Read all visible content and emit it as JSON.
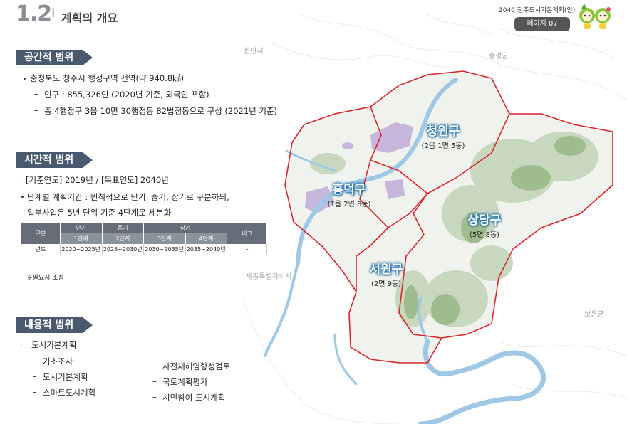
{
  "header": {
    "section_number": "1.2",
    "separator": "I",
    "title": "계획의 개요",
    "doc_title": "2040 청주도시기본계획(안)",
    "page_label": "페이지 07"
  },
  "spatial_scope": {
    "heading": "공간적 범위",
    "main": "충청북도 청주시 행정구역 전역(약 940.8㎢)",
    "sub": [
      "인구 : 855,326인 (2020년 기준, 외국인 포함)",
      "총 4행정구 3읍 10면 30행정동 82법정동으로 구성 (2021년 기준)"
    ]
  },
  "temporal_scope": {
    "heading": "시간적 범위",
    "line1": "[기준연도] 2019년 / [목표연도] 2040년",
    "line2": "단계별 계획기간 : 원칙적으로 단기, 중기, 장기로 구분하되,",
    "line3": "일부사업은 5년 단위 기준 4단계로 세분화",
    "table": {
      "col_gubun": "구분",
      "groups": [
        "단기",
        "중기",
        "장기"
      ],
      "stages": [
        "1단계",
        "2단계",
        "3단계",
        "4단계"
      ],
      "col_bigo": "비고",
      "row_label": "년도",
      "years": [
        "2020~2025년",
        "2025~2030년",
        "2030~2035년",
        "2035~2040년"
      ],
      "bigo_value": "–"
    },
    "note": "※필요시 조정"
  },
  "content_scope": {
    "heading": "내용적 범위",
    "main": "도시기본계획",
    "left_items": [
      "기초조사",
      "도시기본계획",
      "스마트도시계획"
    ],
    "right_items": [
      "사전재해영향성검토",
      "국토계획평가",
      "시민참여 도시계획"
    ]
  },
  "map": {
    "districts": [
      {
        "name": "청원구",
        "sub": "(2읍 1면 5동)"
      },
      {
        "name": "흥덕구",
        "sub": "(1읍 2면 8동)"
      },
      {
        "name": "상당구",
        "sub": "(5면 8동)"
      },
      {
        "name": "서원구",
        "sub": "(2면 9동)"
      }
    ],
    "neighbors": [
      "천안시",
      "증평군",
      "보은군",
      "세종특별자치시"
    ]
  },
  "colors": {
    "section_bg": "#4a5a6e",
    "boundary": "#d9262c",
    "river": "#9ec8e6",
    "district_label": "#1d6ea8",
    "page_badge": "#555555"
  }
}
